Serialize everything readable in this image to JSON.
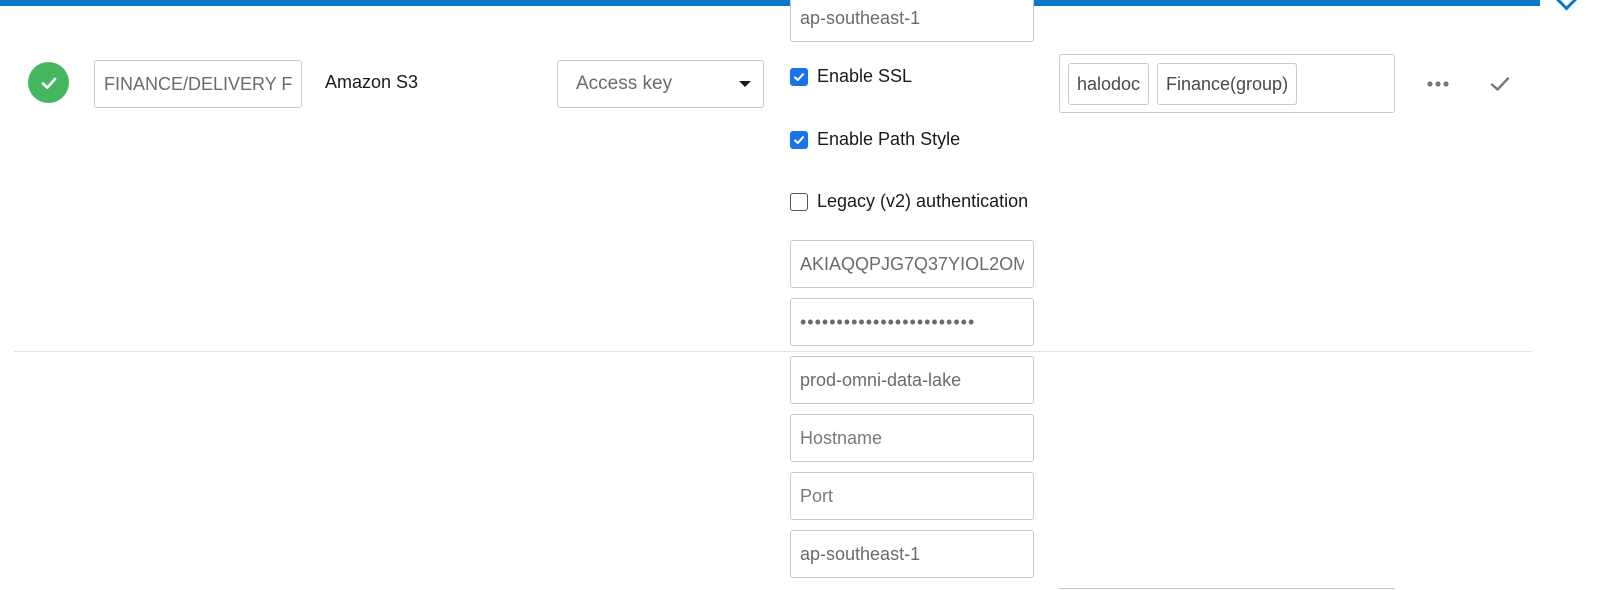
{
  "row": {
    "status": "connected",
    "name_value": "FINANCE/DELIVERY F",
    "storage_type": "Amazon S3",
    "auth_method": {
      "selected": "Access key"
    },
    "settings": {
      "region_top": "ap-southeast-1",
      "enable_ssl": {
        "label": "Enable SSL",
        "checked": true
      },
      "enable_path_style": {
        "label": "Enable Path Style",
        "checked": true
      },
      "legacy_auth": {
        "label": "Legacy (v2) authentication",
        "checked": false
      },
      "access_key_id": "AKIAQQPJG7Q37YIOL2OM",
      "secret_key_mask": "••••••••••••••••••••••••",
      "bucket": "prod-omni-data-lake",
      "hostname_placeholder": "Hostname",
      "port_placeholder": "Port",
      "region": "ap-southeast-1"
    },
    "access_tags": [
      "halodoc",
      "Finance(group)"
    ]
  },
  "icons": {
    "status": "check-circle-icon",
    "more": "ellipsis-icon",
    "confirm": "checkmark-icon",
    "select_caret": "caret-down-icon"
  },
  "colors": {
    "accent_bar": "#0a78c8",
    "status_ok": "#45b85f",
    "checkbox_checked": "#1a73e8",
    "border": "#c9c9c9"
  }
}
